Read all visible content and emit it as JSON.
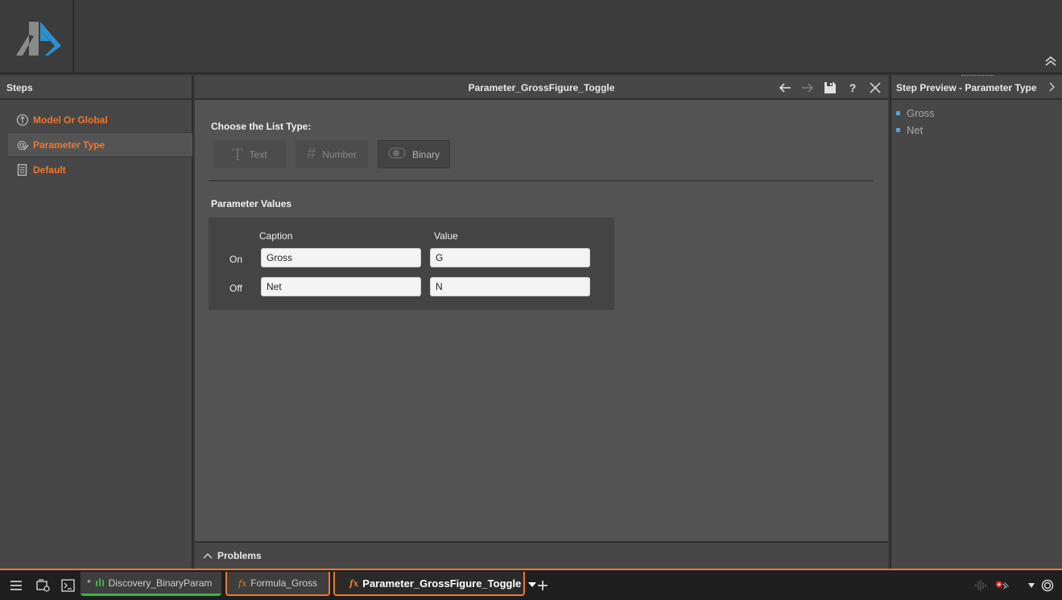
{
  "header": {
    "collapse_icon": "chevron-double-up-icon"
  },
  "steps_panel": {
    "title": "Steps",
    "items": [
      {
        "label": "Model Or Global",
        "icon": "model-global-icon"
      },
      {
        "label": "Parameter Type",
        "icon": "parameter-type-icon",
        "active": true
      },
      {
        "label": "Default",
        "icon": "default-doc-icon"
      }
    ]
  },
  "editor": {
    "title": "Parameter_GrossFigure_Toggle",
    "choose_list_type_label": "Choose the List Type:",
    "list_types": [
      {
        "label": "Text",
        "icon": "text-T-icon",
        "enabled": false
      },
      {
        "label": "Number",
        "icon": "hash-icon",
        "enabled": false
      },
      {
        "label": "Binary",
        "icon": "toggle-icon",
        "selected": true
      }
    ],
    "parameter_values_label": "Parameter Values",
    "columns": {
      "caption": "Caption",
      "value": "Value"
    },
    "rows": [
      {
        "label": "On",
        "caption": "Gross",
        "value": "G"
      },
      {
        "label": "Off",
        "caption": "Net",
        "value": "N"
      }
    ],
    "problems_label": "Problems"
  },
  "preview": {
    "title": "Step Preview - Parameter Type",
    "items": [
      "Gross",
      "Net"
    ],
    "accent": "#5aa1d6"
  },
  "taskbar": {
    "tabs": [
      {
        "label": "Discovery_BinaryParam",
        "prefix": "*",
        "icon": "bar-chart-icon"
      },
      {
        "label": "Formula_Gross",
        "icon": "fx-icon"
      },
      {
        "label": "Parameter_GrossFigure_Toggle",
        "icon": "fx-icon",
        "active": true
      }
    ],
    "add_tab_icon": "plus-icon"
  },
  "colors": {
    "accent": "#f0782d",
    "green": "#3fb24a"
  }
}
